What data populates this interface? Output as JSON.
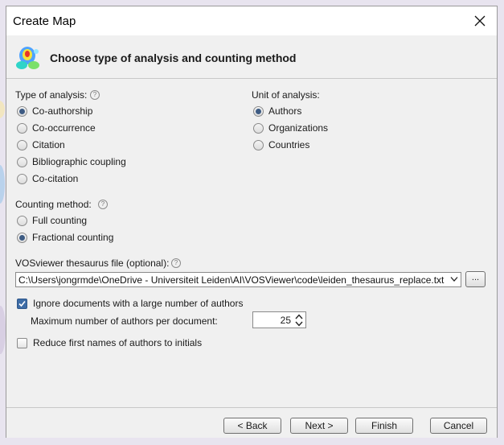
{
  "window": {
    "title": "Create Map"
  },
  "header": {
    "title": "Choose type of analysis and counting method"
  },
  "analysis_type": {
    "label": "Type of analysis:",
    "options": [
      {
        "label": "Co-authorship",
        "selected": true
      },
      {
        "label": "Co-occurrence",
        "selected": false
      },
      {
        "label": "Citation",
        "selected": false
      },
      {
        "label": "Bibliographic coupling",
        "selected": false
      },
      {
        "label": "Co-citation",
        "selected": false
      }
    ]
  },
  "unit": {
    "label": "Unit of analysis:",
    "options": [
      {
        "label": "Authors",
        "selected": true
      },
      {
        "label": "Organizations",
        "selected": false
      },
      {
        "label": "Countries",
        "selected": false
      }
    ]
  },
  "counting": {
    "label": "Counting method:",
    "options": [
      {
        "label": "Full counting",
        "selected": false
      },
      {
        "label": "Fractional counting",
        "selected": true
      }
    ]
  },
  "thesaurus": {
    "label": "VOSviewer thesaurus file (optional):",
    "value": "C:\\Users\\jongrmde\\OneDrive - Universiteit Leiden\\AI\\VOSViewer\\code\\leiden_thesaurus_replace.txt",
    "browse_label": "..."
  },
  "options": {
    "ignore_large": {
      "label": "Ignore documents with a large number of authors",
      "checked": true
    },
    "max_authors": {
      "label": "Maximum number of authors per document:",
      "value": "25"
    },
    "reduce_names": {
      "label": "Reduce first names of authors to initials",
      "checked": false
    }
  },
  "buttons": {
    "back": "< Back",
    "next": "Next >",
    "finish": "Finish",
    "cancel": "Cancel"
  },
  "icons": {
    "help": "?",
    "close": "close-icon",
    "logo": "vosviewer-logo-icon"
  },
  "colors": {
    "radio_selected": "#3d5b83",
    "checkbox_checked": "#3d6ca6"
  }
}
